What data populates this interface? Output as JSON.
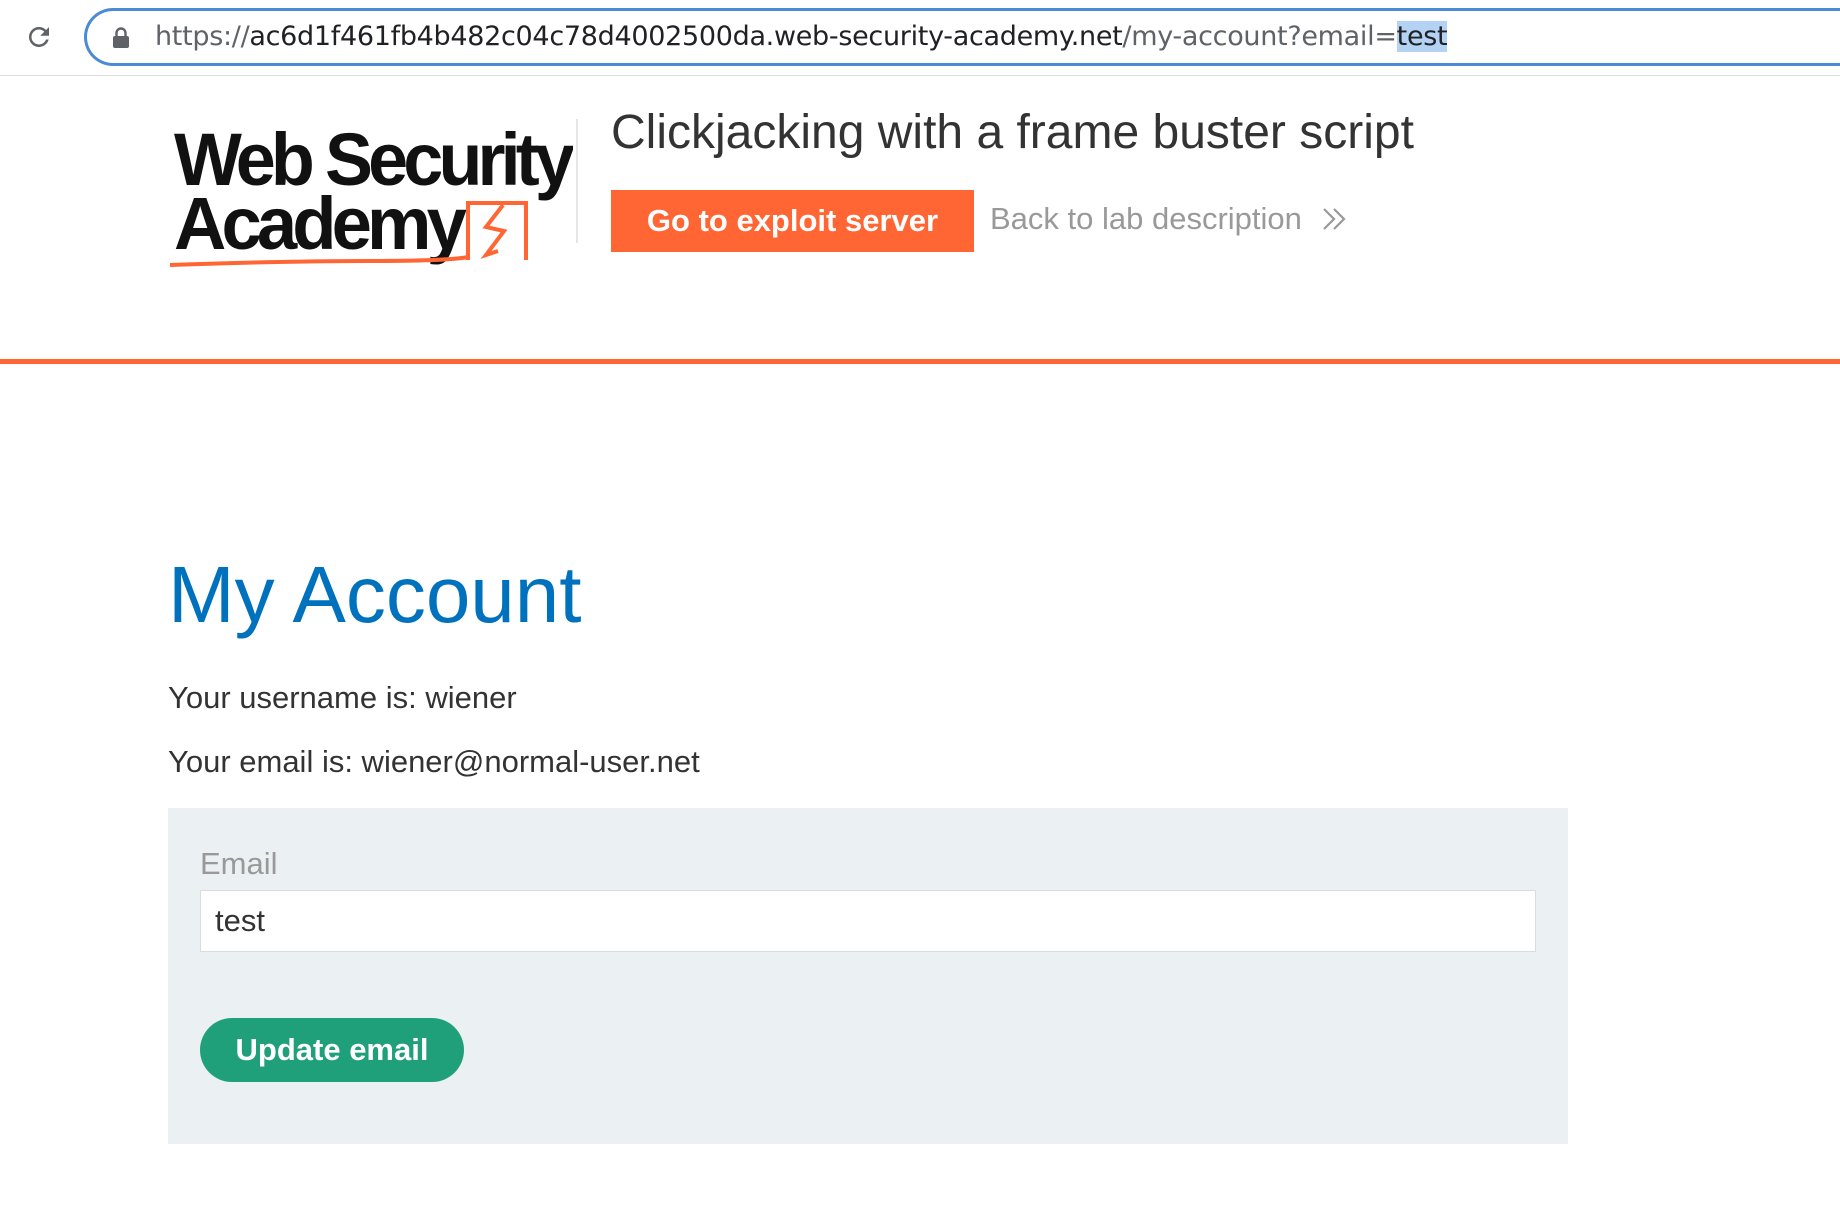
{
  "browser": {
    "url_scheme": "https://",
    "url_host": "ac6d1f461fb4b482c04c78d4002500da.web-security-academy.net",
    "url_path": "/my-account?email=",
    "url_selected": "test"
  },
  "header": {
    "logo_text_line1": "Web Security",
    "logo_text_line2": "Academy",
    "lab_title": "Clickjacking with a frame buster script",
    "exploit_button_label": "Go to exploit server",
    "back_link_label": "Back to lab description",
    "back_link_icon": "double-chevron-right-icon"
  },
  "main": {
    "page_title": "My Account",
    "username_line": "Your username is: wiener",
    "email_line": "Your email is: wiener@normal-user.net",
    "form": {
      "email_label": "Email",
      "email_value": "test",
      "submit_label": "Update email"
    }
  },
  "colors": {
    "accent_orange": "#ff6633",
    "title_blue": "#0071bc",
    "button_green": "#20a07a",
    "panel_bg": "#ebf0f2",
    "omnibox_border": "#4a8ad6",
    "selection_bg": "#b4d2f4"
  },
  "icons": {
    "reload": "reload-icon",
    "lock": "lock-icon",
    "logo_mark": "lightning-box-icon"
  }
}
